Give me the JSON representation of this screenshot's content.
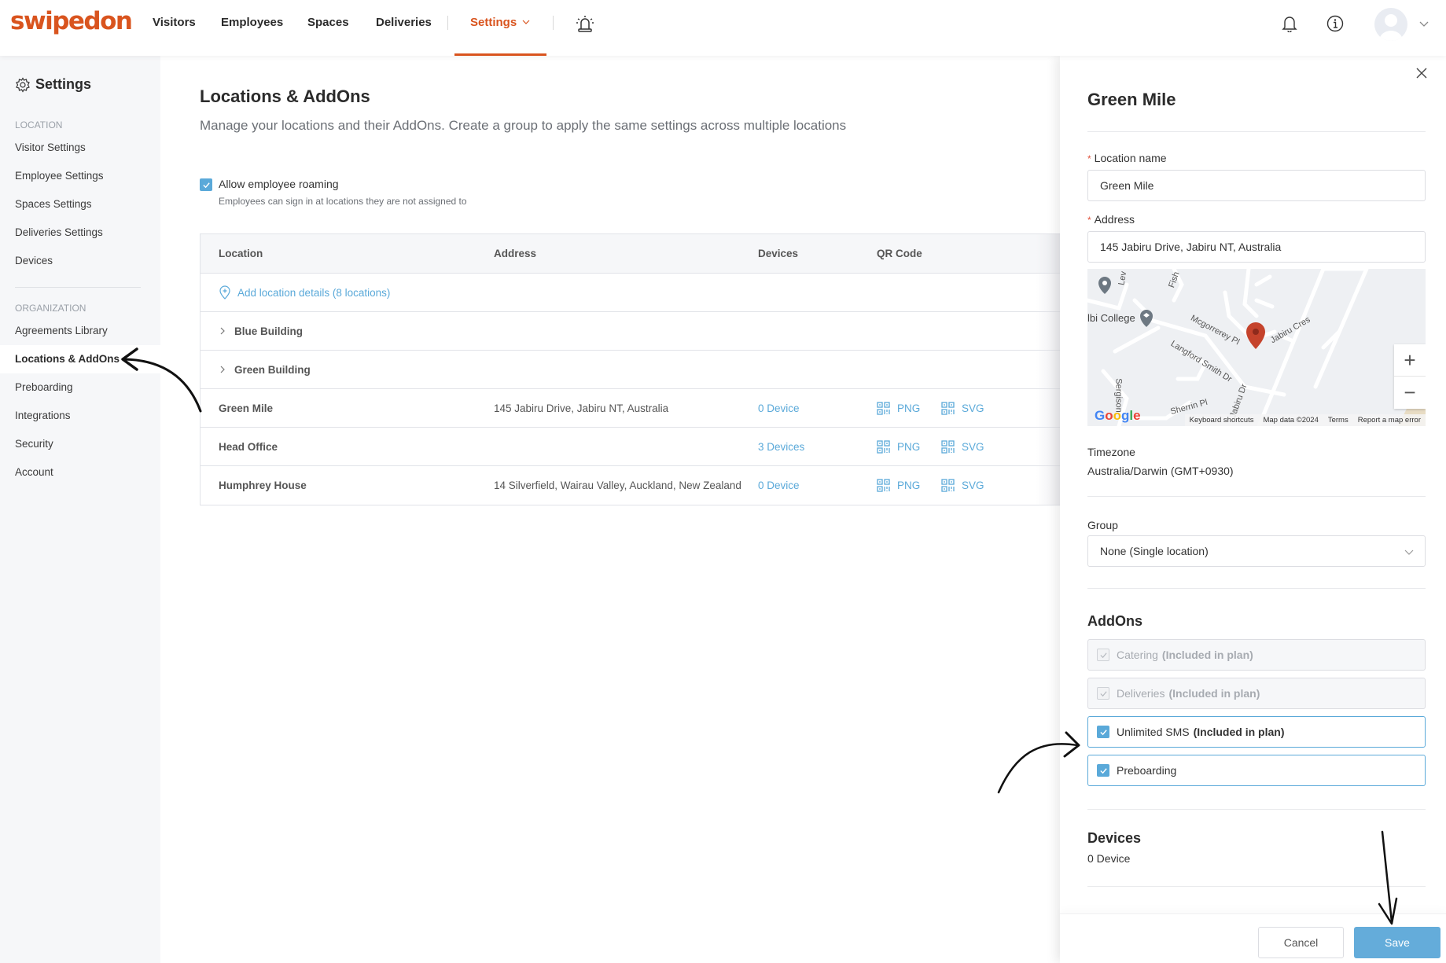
{
  "brand": {
    "name": "swipedon",
    "color": "#d9541e",
    "accent": "#5aa9d9"
  },
  "nav": {
    "items": [
      "Visitors",
      "Employees",
      "Spaces",
      "Deliveries"
    ],
    "settings_label": "Settings",
    "icons": [
      "alarm-icon",
      "bell-icon",
      "info-icon",
      "avatar"
    ]
  },
  "sidebar": {
    "title": "Settings",
    "sections": [
      {
        "label": "LOCATION",
        "items": [
          "Visitor Settings",
          "Employee Settings",
          "Spaces Settings",
          "Deliveries Settings",
          "Devices"
        ]
      },
      {
        "label": "ORGANIZATION",
        "items": [
          "Agreements Library",
          "Locations & AddOns",
          "Preboarding",
          "Integrations",
          "Security",
          "Account"
        ]
      }
    ],
    "active_item": "Locations & AddOns"
  },
  "main": {
    "title": "Locations & AddOns",
    "description": "Manage your locations and their AddOns. Create a group to apply the same settings across multiple locations",
    "roaming": {
      "checked": true,
      "label": "Allow employee roaming",
      "sublabel": "Employees can sign in at locations they are not assigned to"
    },
    "table": {
      "columns": [
        "Location",
        "Address",
        "Devices",
        "QR Code"
      ],
      "add_row": "Add location details (8 locations)",
      "groups": [
        "Blue Building",
        "Green Building"
      ],
      "rows": [
        {
          "location": "Green Mile",
          "address": "145 Jabiru Drive, Jabiru NT, Australia",
          "devices": "0 Device",
          "qr_png": "PNG",
          "qr_svg": "SVG"
        },
        {
          "location": "Head Office",
          "address": "",
          "devices": "3 Devices",
          "qr_png": "PNG",
          "qr_svg": "SVG"
        },
        {
          "location": "Humphrey House",
          "address": "14 Silverfield, Wairau Valley, Auckland, New Zealand",
          "devices": "0 Device",
          "qr_png": "PNG",
          "qr_svg": "SVG"
        }
      ]
    }
  },
  "drawer": {
    "title": "Green Mile",
    "location_name_label": "Location name",
    "location_name_value": "Green Mile",
    "address_label": "Address",
    "address_value": "145 Jabiru Drive, Jabiru NT, Australia",
    "map": {
      "labels": [
        "lbi College",
        "Mcgorrerey Pl",
        "Jabiru Cres",
        "Langford Smith Dr",
        "Jabiru Dr",
        "Sherrin Pl",
        "Sergison",
        "Fish",
        "Lev"
      ],
      "logo": "Google",
      "footer": [
        "Keyboard shortcuts",
        "Map data ©2024",
        "Terms",
        "Report a map error"
      ],
      "zoom_in": "+",
      "zoom_out": "−"
    },
    "timezone_label": "Timezone",
    "timezone_value": "Australia/Darwin (GMT+0930)",
    "group_label": "Group",
    "group_value": "None (Single location)",
    "addons_heading": "AddOns",
    "addons": [
      {
        "name": "Catering",
        "suffix": "(Included in plan)",
        "checked": true,
        "disabled": true
      },
      {
        "name": "Deliveries",
        "suffix": "(Included in plan)",
        "checked": true,
        "disabled": true
      },
      {
        "name": "Unlimited SMS",
        "suffix": "(Included in plan)",
        "checked": true,
        "disabled": false
      },
      {
        "name": "Preboarding",
        "suffix": "",
        "checked": true,
        "disabled": false
      }
    ],
    "devices_heading": "Devices",
    "devices_value": "0 Device",
    "cancel_label": "Cancel",
    "save_label": "Save"
  }
}
